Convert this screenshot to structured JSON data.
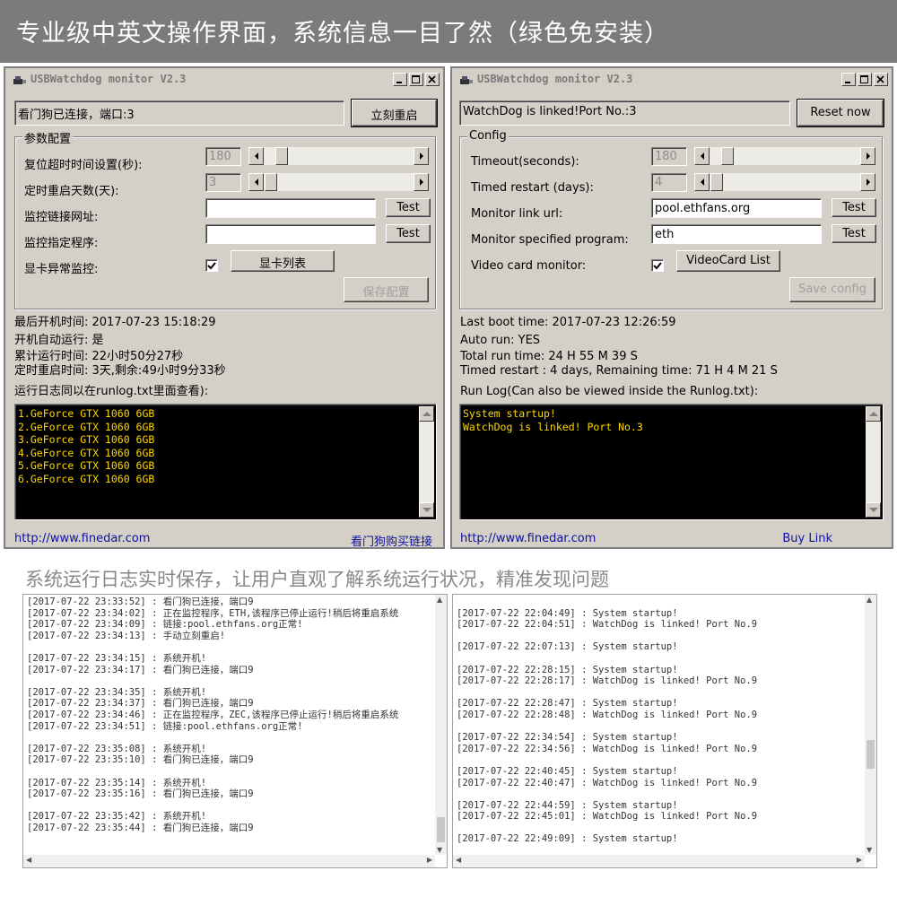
{
  "banner": {
    "text": "专业级中英文操作界面，系统信息一目了然（绿色免安装）"
  },
  "left_window": {
    "title": "USBWatchdog monitor V2.3",
    "status": "看门狗已连接，端口:3",
    "reset_button": "立刻重启",
    "group_title": "参数配置",
    "timeout_label": "复位超时时间设置(秒):",
    "timeout_value": "180",
    "restart_label": "定时重启天数(天):",
    "restart_value": "3",
    "url_label": "监控链接网址:",
    "url_value": "",
    "program_label": "监控指定程序:",
    "program_value": "",
    "test_label": "Test",
    "vc_label": "显卡异常监控:",
    "vc_list_button": "显卡列表",
    "save_button": "保存配置",
    "boot_time": "最后开机时间:  2017-07-23 15:18:29",
    "auto_run": "开机自动运行: 是",
    "total_run": "累计运行时间:  22小时50分27秒",
    "timed_restart": "定时重启时间:  3天,剩余:49小时9分33秒",
    "log_label": "运行日志同以在runlog.txt里面查看):",
    "console_lines": [
      "1.GeForce GTX 1060 6GB",
      "2.GeForce GTX 1060 6GB",
      "3.GeForce GTX 1060 6GB",
      "4.GeForce GTX 1060 6GB",
      "5.GeForce GTX 1060 6GB",
      "6.GeForce GTX 1060 6GB"
    ],
    "site_link": "http://www.finedar.com",
    "buy_link": "看门狗购买链接"
  },
  "right_window": {
    "title": "USBWatchdog monitor V2.3",
    "status": "WatchDog is linked!Port No.:3",
    "reset_button": "Reset now",
    "group_title": "Config",
    "timeout_label": "Timeout(seconds):",
    "timeout_value": "180",
    "restart_label": "Timed restart (days):",
    "restart_value": "4",
    "url_label": "Monitor link url:",
    "url_value": "pool.ethfans.org",
    "program_label": "Monitor specified program:",
    "program_value": "eth",
    "test_label": "Test",
    "vc_label": "Video card monitor:",
    "vc_list_button": "VideoCard List",
    "save_button": "Save config",
    "boot_time": "Last boot time: 2017-07-23 12:26:59",
    "auto_run": "Auto run: YES",
    "total_run": "Total run time: 24 H 55 M 39 S",
    "timed_restart": "Timed restart : 4 days,  Remaining time: 71 H 4 M 21 S",
    "log_label": "Run Log(Can also be viewed inside the Runlog.txt):",
    "console_lines": [
      "System startup!",
      "WatchDog is linked! Port No.3"
    ],
    "site_link": "http://www.finedar.com",
    "buy_link": "Buy Link"
  },
  "section2": {
    "text": "系统运行日志实时保存，让用户直观了解系统运行状况，精准发现问题"
  },
  "log_left": {
    "lines": [
      "[2017-07-22 23:33:52] : 看门狗已连接，端口9",
      "[2017-07-22 23:34:02] : 正在监控程序，ETH,该程序已停止运行!稍后将重启系统",
      "[2017-07-22 23:34:09] : 链接:pool.ethfans.org正常!",
      "[2017-07-22 23:34:13] : 手动立刻重启!",
      "",
      "[2017-07-22 23:34:15] : 系统开机!",
      "[2017-07-22 23:34:17] : 看门狗已连接，端口9",
      "",
      "[2017-07-22 23:34:35] : 系统开机!",
      "[2017-07-22 23:34:37] : 看门狗已连接，端口9",
      "[2017-07-22 23:34:46] : 正在监控程序，ZEC,该程序已停止运行!稍后将重启系统",
      "[2017-07-22 23:34:51] : 链接:pool.ethfans.org正常!",
      "",
      "[2017-07-22 23:35:08] : 系统开机!",
      "[2017-07-22 23:35:10] : 看门狗已连接，端口9",
      "",
      "[2017-07-22 23:35:14] : 系统开机!",
      "[2017-07-22 23:35:16] : 看门狗已连接，端口9",
      "",
      "[2017-07-22 23:35:42] : 系统开机!",
      "[2017-07-22 23:35:44] : 看门狗已连接，端口9"
    ]
  },
  "log_right": {
    "lines": [
      "",
      "[2017-07-22 22:04:49] : System startup!",
      "[2017-07-22 22:04:51] : WatchDog is linked! Port No.9",
      "",
      "[2017-07-22 22:07:13] : System startup!",
      "",
      "[2017-07-22 22:28:15] : System startup!",
      "[2017-07-22 22:28:17] : WatchDog is linked! Port No.9",
      "",
      "[2017-07-22 22:28:47] : System startup!",
      "[2017-07-22 22:28:48] : WatchDog is linked! Port No.9",
      "",
      "[2017-07-22 22:34:54] : System startup!",
      "[2017-07-22 22:34:56] : WatchDog is linked! Port No.9",
      "",
      "[2017-07-22 22:40:45] : System startup!",
      "[2017-07-22 22:40:47] : WatchDog is linked! Port No.9",
      "",
      "[2017-07-22 22:44:59] : System startup!",
      "[2017-07-22 22:45:01] : WatchDog is linked! Port No.9",
      "",
      "[2017-07-22 22:49:09] : System startup!"
    ]
  },
  "colors": {
    "banner_bg": "#7b7b7b",
    "window_bg": "#d4d0c8",
    "console_text": "#ffd800",
    "link": "#1010a0"
  },
  "icons": {
    "app": "usb-watchdog-icon",
    "minimize": "minimize-icon",
    "maximize": "maximize-icon",
    "close": "close-icon",
    "check": "checkmark-icon"
  }
}
